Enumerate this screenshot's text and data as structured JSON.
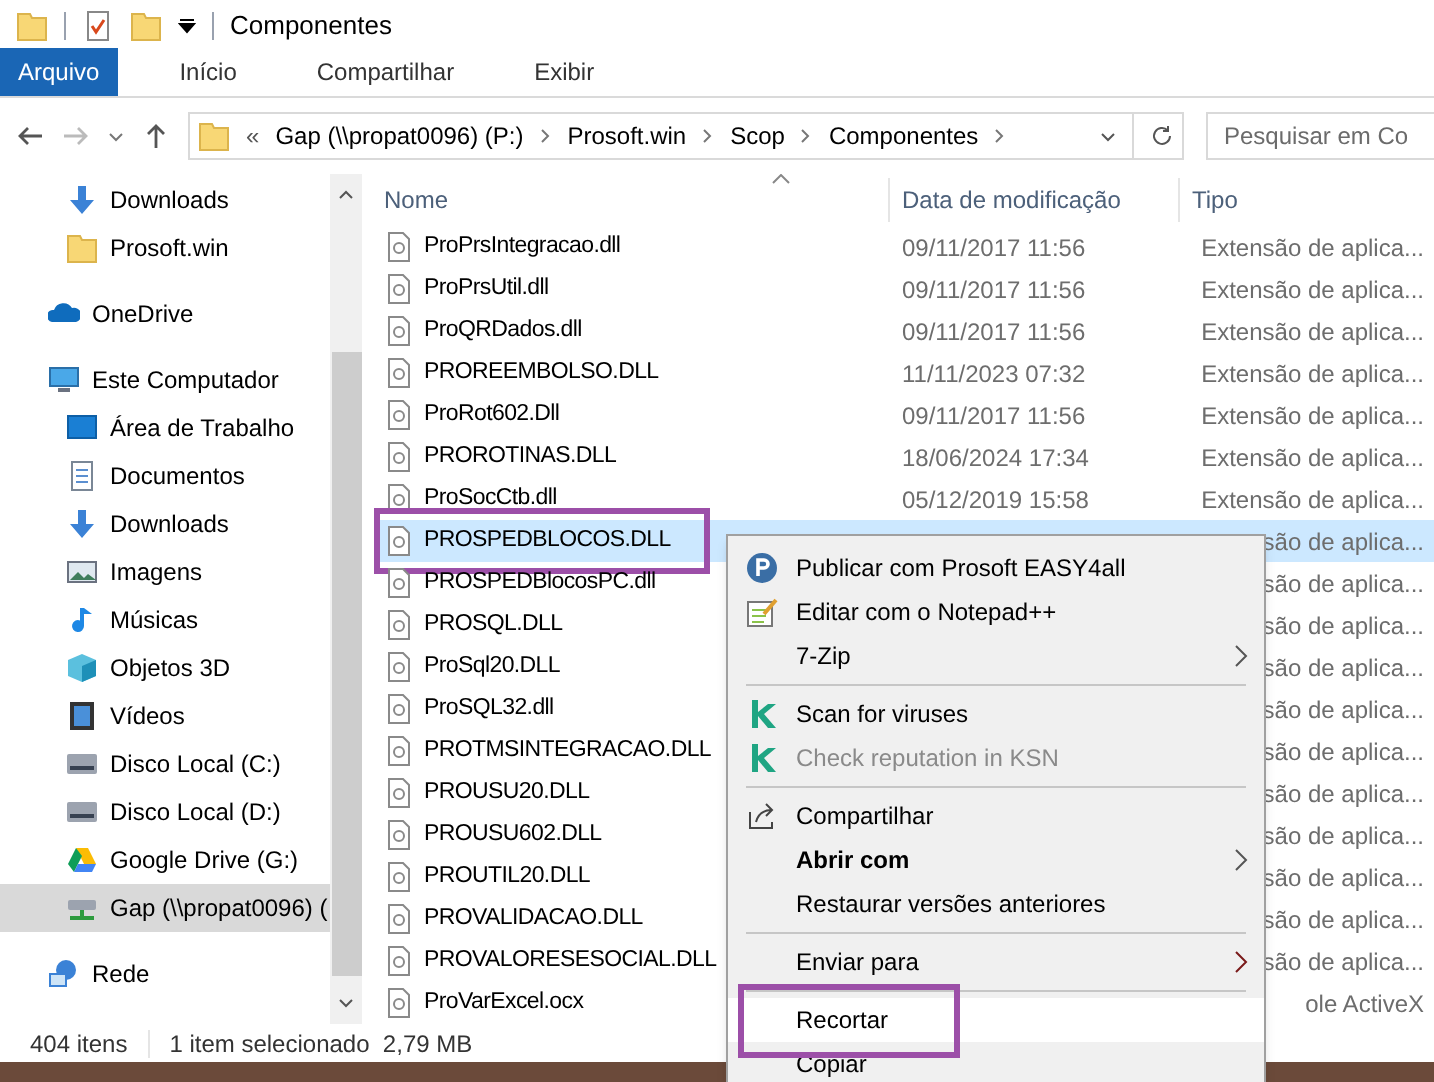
{
  "window": {
    "title": "Componentes"
  },
  "ribbon_tabs": [
    {
      "label": "Arquivo",
      "selected": true
    },
    {
      "label": "Início",
      "selected": false
    },
    {
      "label": "Compartilhar",
      "selected": false
    },
    {
      "label": "Exibir",
      "selected": false
    }
  ],
  "address_bar": {
    "overflow": "«",
    "path": [
      "Gap (\\\\propat0096) (P:)",
      "Prosoft.win",
      "Scop",
      "Componentes"
    ]
  },
  "search": {
    "placeholder": "Pesquisar em Co"
  },
  "navigation": {
    "quick_access_children": [
      {
        "kind": "download",
        "label": "Downloads",
        "selected": false
      },
      {
        "kind": "folder",
        "label": "Prosoft.win",
        "selected": false
      }
    ],
    "tree": [
      {
        "kind": "onedrive",
        "label": "OneDrive",
        "selected": false
      },
      {
        "kind": "pc",
        "label": "Este Computador",
        "selected": false,
        "children": [
          {
            "kind": "desktop",
            "label": "Área de Trabalho",
            "selected": false
          },
          {
            "kind": "documents",
            "label": "Documentos",
            "selected": false
          },
          {
            "kind": "download",
            "label": "Downloads",
            "selected": false
          },
          {
            "kind": "images",
            "label": "Imagens",
            "selected": false
          },
          {
            "kind": "music",
            "label": "Músicas",
            "selected": false
          },
          {
            "kind": "cube",
            "label": "Objetos 3D",
            "selected": false
          },
          {
            "kind": "videos",
            "label": "Vídeos",
            "selected": false
          },
          {
            "kind": "drive",
            "label": "Disco Local (C:)",
            "selected": false
          },
          {
            "kind": "drive",
            "label": "Disco Local (D:)",
            "selected": false
          },
          {
            "kind": "gdrive",
            "label": "Google Drive (G:)",
            "selected": false
          },
          {
            "kind": "netdrive",
            "label": "Gap (\\\\propat0096) (",
            "selected": true
          }
        ]
      },
      {
        "kind": "network",
        "label": "Rede",
        "selected": false
      }
    ]
  },
  "file_list": {
    "columns": [
      "Nome",
      "Data de modificação",
      "Tipo"
    ],
    "rows": [
      {
        "name": "ProPrsIntegracao.dll",
        "date": "09/11/2017 11:56",
        "type": "Extensão de aplica...",
        "selected": false
      },
      {
        "name": "ProPrsUtil.dll",
        "date": "09/11/2017 11:56",
        "type": "Extensão de aplica...",
        "selected": false
      },
      {
        "name": "ProQRDados.dll",
        "date": "09/11/2017 11:56",
        "type": "Extensão de aplica...",
        "selected": false
      },
      {
        "name": "PROREEMBOLSO.DLL",
        "date": "11/11/2023 07:32",
        "type": "Extensão de aplica...",
        "selected": false
      },
      {
        "name": "ProRot602.Dll",
        "date": "09/11/2017 11:56",
        "type": "Extensão de aplica...",
        "selected": false
      },
      {
        "name": "PROROTINAS.DLL",
        "date": "18/06/2024 17:34",
        "type": "Extensão de aplica...",
        "selected": false
      },
      {
        "name": "ProSocCtb.dll",
        "date": "05/12/2019 15:58",
        "type": "Extensão de aplica...",
        "selected": false
      },
      {
        "name": "PROSPEDBLOCOS.DLL",
        "type": "são de aplica...",
        "selected": true,
        "highlighted": true
      },
      {
        "name": "PROSPEDBlocosPC.dll",
        "type": "são de aplica...",
        "selected": false
      },
      {
        "name": "PROSQL.DLL",
        "type": "são de aplica...",
        "selected": false
      },
      {
        "name": "ProSql20.DLL",
        "type": "são de aplica...",
        "selected": false
      },
      {
        "name": "ProSQL32.dll",
        "type": "são de aplica...",
        "selected": false
      },
      {
        "name": "PROTMSINTEGRACAO.DLL",
        "type": "são de aplica...",
        "selected": false
      },
      {
        "name": "PROUSU20.DLL",
        "type": "são de aplica...",
        "selected": false
      },
      {
        "name": "PROUSU602.DLL",
        "type": "são de aplica...",
        "selected": false
      },
      {
        "name": "PROUTIL20.DLL",
        "type": "são de aplica...",
        "selected": false
      },
      {
        "name": "PROVALIDACAO.DLL",
        "type": "são de aplica...",
        "selected": false
      },
      {
        "name": "PROVALORESESOCIAL.DLL",
        "type": "são de aplica...",
        "selected": false
      },
      {
        "name": "ProVarExcel.ocx",
        "type": "ole ActiveX",
        "selected": false
      }
    ]
  },
  "status_bar": {
    "count": "404 itens",
    "selection": "1 item selecionado  2,79 MB"
  },
  "context_menu": [
    {
      "kind": "prosoft",
      "label": "Publicar com Prosoft EASY4all"
    },
    {
      "kind": "notepad",
      "label": "Editar com o Notepad++"
    },
    {
      "kind": "plain",
      "label": "7-Zip",
      "submenu": true
    },
    {
      "kind": "separator"
    },
    {
      "kind": "kaspersky",
      "label": "Scan for viruses"
    },
    {
      "kind": "kaspersky",
      "label": "Check reputation in KSN",
      "disabled": true
    },
    {
      "kind": "separator"
    },
    {
      "kind": "share",
      "label": "Compartilhar"
    },
    {
      "kind": "plain",
      "label": "Abrir com",
      "submenu": true,
      "bold": true
    },
    {
      "kind": "plain",
      "label": "Restaurar versões anteriores"
    },
    {
      "kind": "separator"
    },
    {
      "kind": "plain",
      "label": "Enviar para",
      "submenu": true
    },
    {
      "kind": "separator"
    },
    {
      "kind": "plain",
      "label": "Recortar",
      "selected": true,
      "highlighted": true
    },
    {
      "kind": "plain",
      "label": "Copiar"
    }
  ]
}
